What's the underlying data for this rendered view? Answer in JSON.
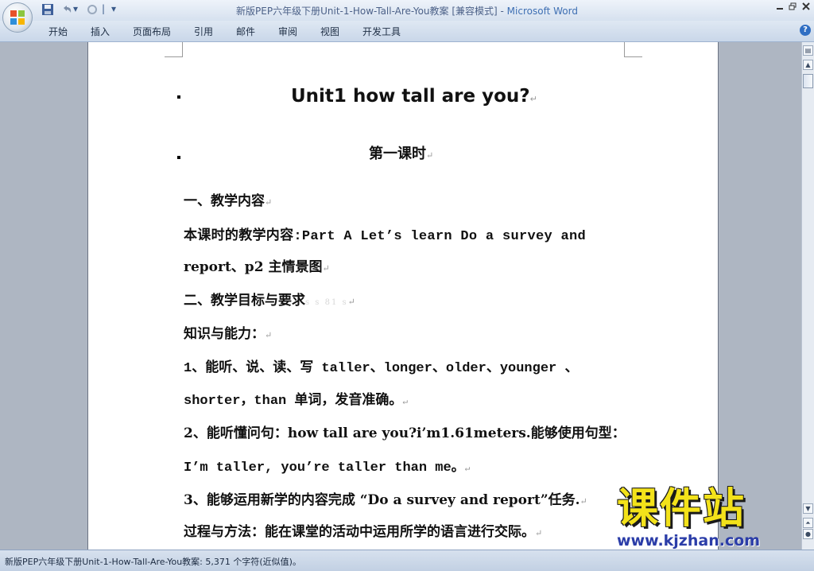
{
  "window": {
    "title": "新版PEP六年级下册Unit-1-How-Tall-Are-You教案 [兼容模式]",
    "separator": " - ",
    "app_name": "Microsoft Word"
  },
  "quick_access": {
    "save_icon": "save-icon",
    "undo_icon": "undo-icon",
    "redo_icon": "redo-icon",
    "customize_icon": "dropdown-icon"
  },
  "ribbon": {
    "tabs": [
      "开始",
      "插入",
      "页面布局",
      "引用",
      "邮件",
      "审阅",
      "视图",
      "开发工具"
    ],
    "help": "?"
  },
  "document": {
    "heading": "Unit1 how tall are you?",
    "subheading": "第一课时",
    "lines": [
      "一、教学内容",
      "本课时的教学内容:Part A  Let’s learn Do a survey and",
      "report、p2 主情景图",
      "二、教学目标与要求",
      "知识与能力：",
      "1、能听、说、读、写 taller、longer、older、younger 、",
      "shorter，than 单词，发音准确。",
      "2、能听懂问句：how tall are you?i’m1.61meters.能够使用句型：",
      "I’m taller, you’re taller than me。",
      "3、能够运用新学的内容完成 “Do a survey and report”任务.",
      "过程与方法：能在课堂的活动中运用所学的语言进行交际。"
    ],
    "paragraph_mark": "↵",
    "faint_text": "s s 81 s"
  },
  "status_bar": {
    "text": "新版PEP六年级下册Unit-1-How-Tall-Are-You教案: 5,371 个字符(近似值)。"
  },
  "watermark": {
    "brand": "课件站",
    "url": "www.kjzhan.com"
  }
}
